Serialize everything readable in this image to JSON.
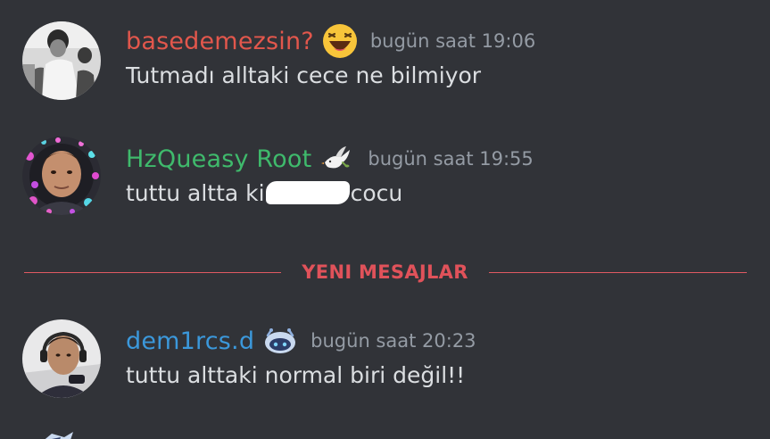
{
  "colors": {
    "background": "#313338",
    "message_text": "#dbdee1",
    "timestamp": "#949ba4",
    "new_messages": "#e0525a"
  },
  "messages": [
    {
      "username": "basedemezsin?",
      "username_color": "#e2574c",
      "badge_icon": "laughing-emoji-icon",
      "timestamp": "bugün saat 19:06",
      "text": "Tutmadı alltaki cece ne bilmiyor"
    },
    {
      "username": "HzQueasy Root",
      "username_color": "#3fba6c",
      "badge_icon": "dove-icon",
      "timestamp": "bugün saat 19:55",
      "text_before": "tuttu altta ki",
      "text_after": "cocu"
    },
    {
      "username": "dem1rcs.d",
      "username_color": "#3b98db",
      "badge_icon": "robot-blob-icon",
      "timestamp": "bugün saat 20:23",
      "text": "tuttu alttaki normal biri değil!!"
    }
  ],
  "divider": {
    "label": "YENI MESAJLAR"
  }
}
